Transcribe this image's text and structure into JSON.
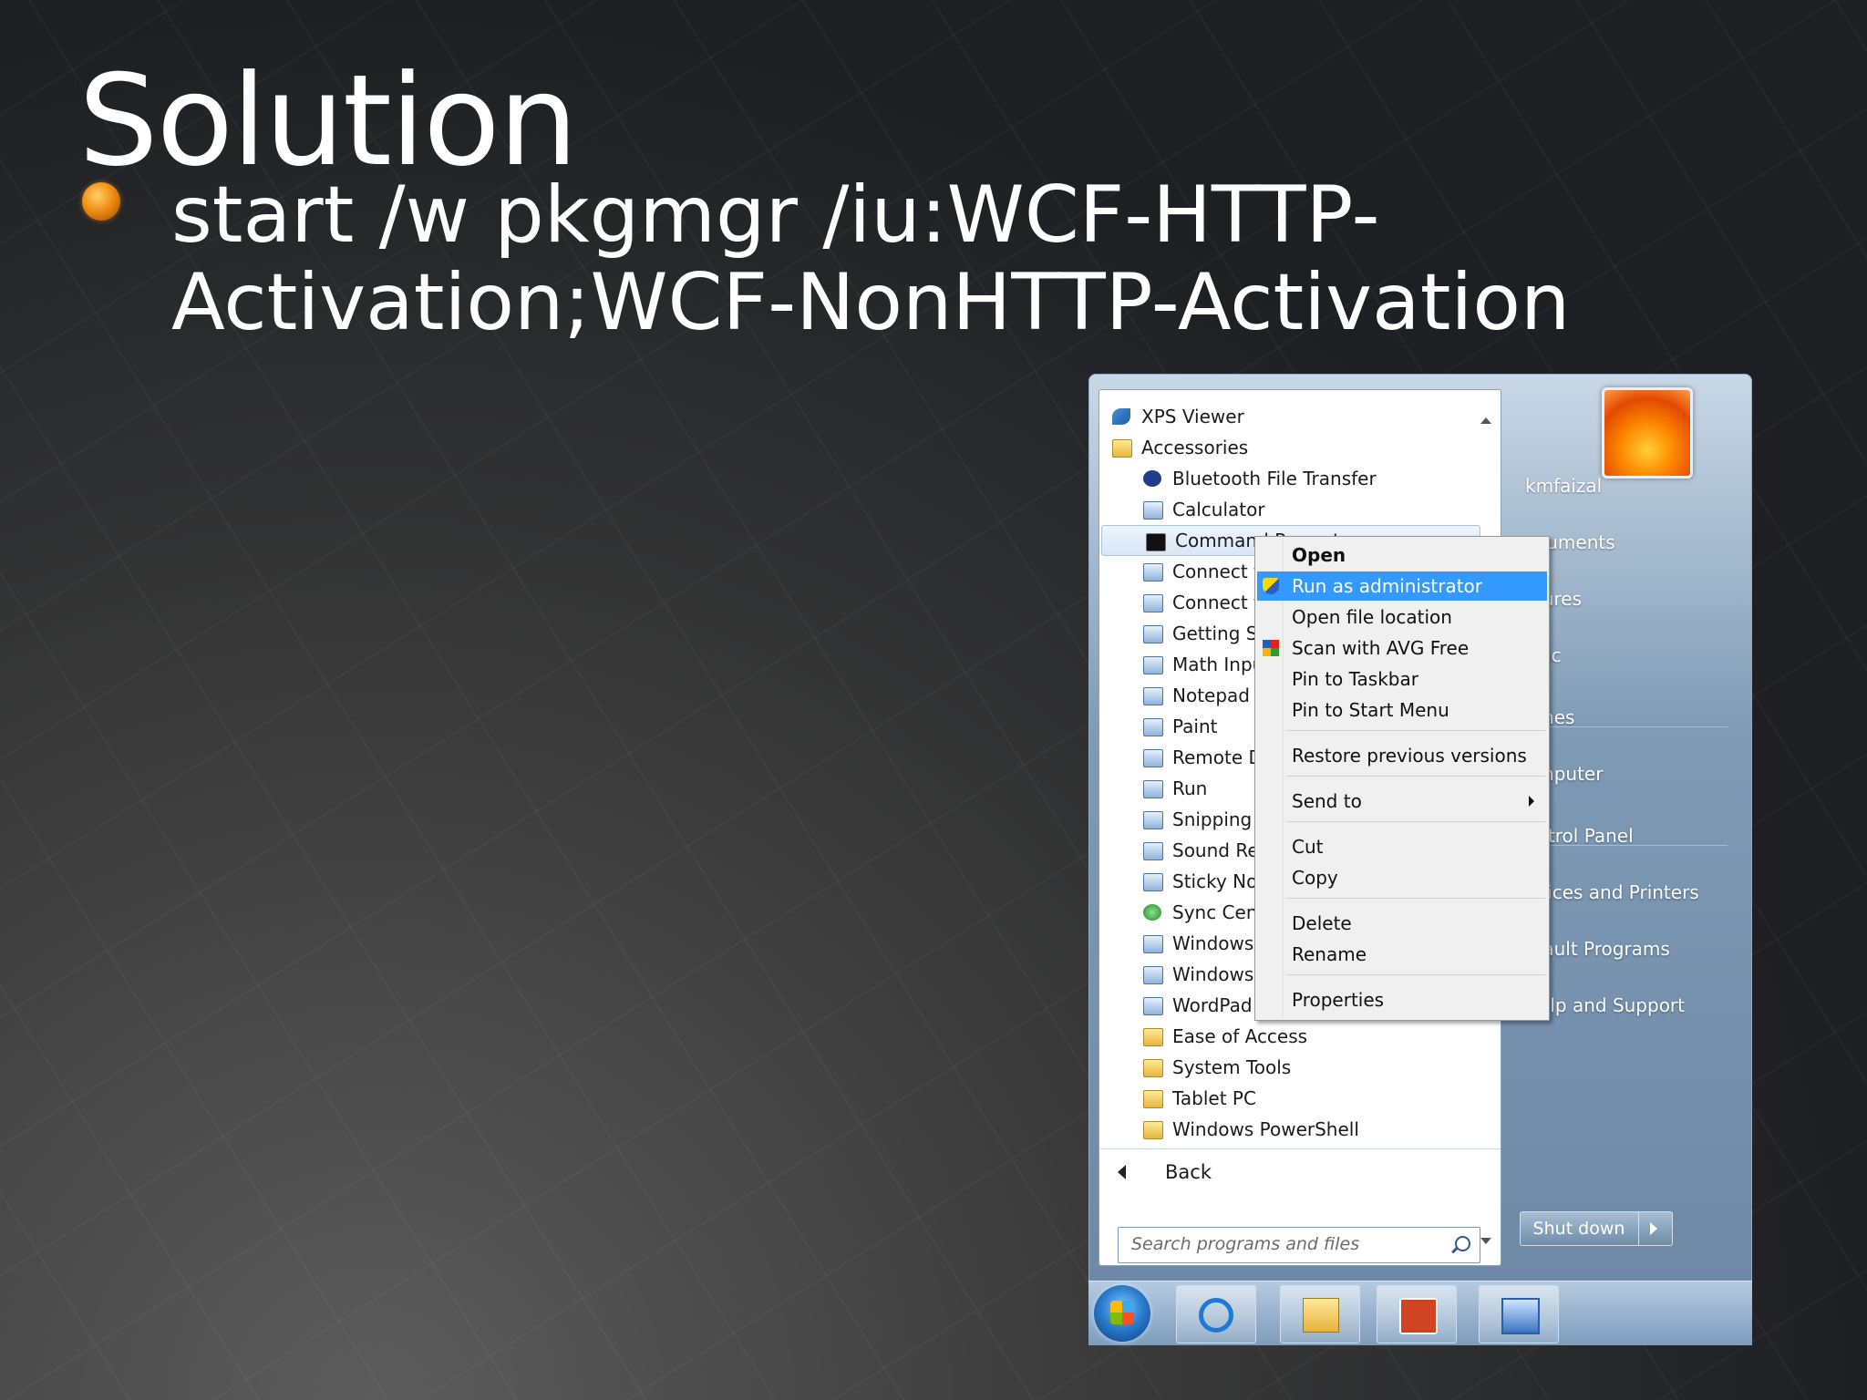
{
  "slide": {
    "title": "Solution",
    "bullet": "start /w pkgmgr /iu:WCF-HTTP-Activation;WCF-NonHTTP-Activation"
  },
  "start_menu": {
    "programs": [
      {
        "label": "XPS Viewer",
        "icon": "xps-icon",
        "level": 0
      },
      {
        "label": "Accessories",
        "icon": "folder-icon",
        "level": 0
      },
      {
        "label": "Bluetooth File Transfer",
        "icon": "bluetooth-icon",
        "level": 1
      },
      {
        "label": "Calculator",
        "icon": "calculator-icon",
        "level": 1
      },
      {
        "label": "Command Prompt",
        "icon": "command-prompt-icon",
        "level": 1,
        "highlighted": true
      },
      {
        "label": "Connect t",
        "icon": "network-projector-icon",
        "level": 1
      },
      {
        "label": "Connect t",
        "icon": "remote-connect-icon",
        "level": 1
      },
      {
        "label": "Getting St",
        "icon": "getting-started-icon",
        "level": 1
      },
      {
        "label": "Math Inpu",
        "icon": "math-input-icon",
        "level": 1
      },
      {
        "label": "Notepad",
        "icon": "notepad-icon",
        "level": 1
      },
      {
        "label": "Paint",
        "icon": "paint-icon",
        "level": 1
      },
      {
        "label": "Remote D",
        "icon": "remote-desktop-icon",
        "level": 1
      },
      {
        "label": "Run",
        "icon": "run-icon",
        "level": 1
      },
      {
        "label": "Snipping T",
        "icon": "snipping-icon",
        "level": 1
      },
      {
        "label": "Sound Rec",
        "icon": "microphone-icon",
        "level": 1
      },
      {
        "label": "Sticky Not",
        "icon": "sticky-notes-icon",
        "level": 1
      },
      {
        "label": "Sync Cent",
        "icon": "sync-icon",
        "level": 1
      },
      {
        "label": "Windows",
        "icon": "windows-explorer-icon",
        "level": 1
      },
      {
        "label": "Windows",
        "icon": "windows-mobility-icon",
        "level": 1
      },
      {
        "label": "WordPad",
        "icon": "wordpad-icon",
        "level": 1
      },
      {
        "label": "Ease of Access",
        "icon": "folder-icon",
        "level": 1
      },
      {
        "label": "System Tools",
        "icon": "folder-icon",
        "level": 1
      },
      {
        "label": "Tablet PC",
        "icon": "folder-icon",
        "level": 1
      },
      {
        "label": "Windows PowerShell",
        "icon": "folder-icon",
        "level": 1
      }
    ],
    "back_label": "Back",
    "search_placeholder": "Search programs and files",
    "right_items": [
      "kmfaizal",
      "ocuments",
      "ctures",
      "usic",
      "ames",
      "omputer",
      "ontrol Panel",
      "evices and Printers",
      "efault Programs",
      "Help and Support"
    ],
    "shutdown_label": "Shut down"
  },
  "context_menu": {
    "items": [
      "Open",
      "Run as administrator",
      "Open file location",
      "Scan with AVG Free",
      "Pin to Taskbar",
      "Pin to Start Menu",
      "Restore previous versions",
      "Send to",
      "Cut",
      "Copy",
      "Delete",
      "Rename",
      "Properties"
    ],
    "selected": "Run as administrator",
    "default": "Open"
  },
  "taskbar": {
    "items": [
      "start-orb",
      "internet-explorer-icon",
      "windows-explorer-icon",
      "powerpoint-icon",
      "remote-desktop-icon"
    ]
  },
  "colors": {
    "selection": "#3399ff",
    "bullet": "#f08f12"
  }
}
